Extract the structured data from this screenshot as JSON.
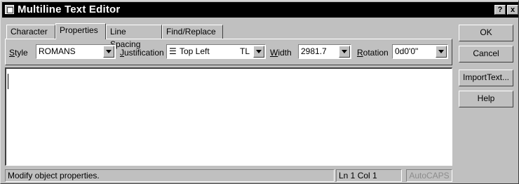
{
  "window": {
    "title": "Multiline Text Editor",
    "help_label": "?",
    "close_label": "x"
  },
  "tabs": [
    {
      "label": "Character",
      "active": false
    },
    {
      "label": "Properties",
      "active": true
    },
    {
      "label": "Line Spacing",
      "active": false
    },
    {
      "label": "Find/Replace",
      "active": false
    }
  ],
  "properties": {
    "style": {
      "label": "Style",
      "value": "ROMANS"
    },
    "justification": {
      "label": "Justification",
      "value": "Top Left",
      "code": "TL"
    },
    "width": {
      "label": "Width",
      "value": "2981.7"
    },
    "rotation": {
      "label": "Rotation",
      "value": "0d0'0\""
    }
  },
  "buttons": {
    "ok": "OK",
    "cancel": "Cancel",
    "import_text": "ImportText...",
    "help": "Help"
  },
  "editor": {
    "text": ""
  },
  "status": {
    "message": "Modify object properties.",
    "position": "Ln 1 Col 1",
    "autocaps": "AutoCAPS"
  },
  "colors": {
    "titlebar": "#000000",
    "face": "#c0c0c0",
    "editor_bg": "#ffffff"
  }
}
